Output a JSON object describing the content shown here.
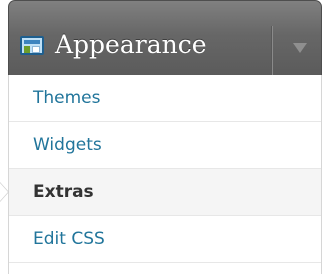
{
  "menu": {
    "title": "Appearance",
    "icon": "appearance-icon",
    "toggle_icon": "chevron-down-icon",
    "items": [
      {
        "label": "Themes",
        "current": false
      },
      {
        "label": "Widgets",
        "current": false
      },
      {
        "label": "Extras",
        "current": true
      },
      {
        "label": "Edit CSS",
        "current": false
      }
    ]
  },
  "colors": {
    "header_bg": "#676767",
    "link": "#21759b",
    "current_text": "#333333"
  }
}
